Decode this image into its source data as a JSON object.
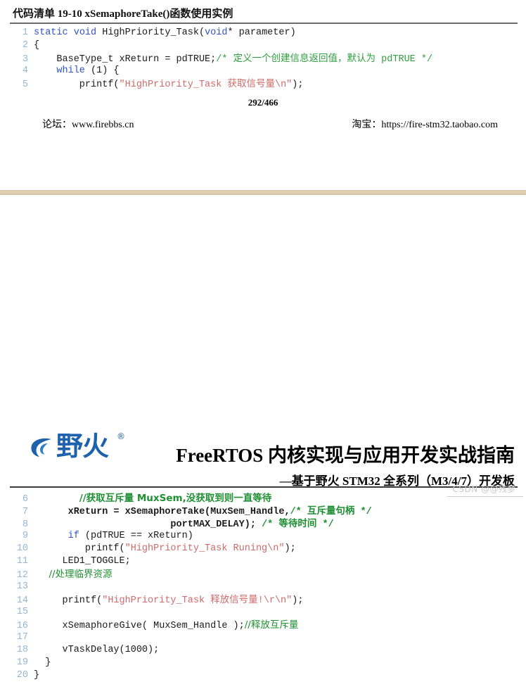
{
  "page_top": {
    "listing_title": "代码清单 19-10 xSemaphoreTake()函数使用实例",
    "page_number": "292",
    "page_separator": "/",
    "page_total": "466",
    "footer_left": "论坛：www.firebbs.cn",
    "footer_right": "淘宝：https://fire-stm32.taobao.com",
    "code_lines": [
      {
        "n": "1",
        "parts": [
          {
            "t": "static",
            "c": "kw"
          },
          {
            "t": " "
          },
          {
            "t": "void",
            "c": "kw"
          },
          {
            "t": " HighPriority_Task("
          },
          {
            "t": "void",
            "c": "kw"
          },
          {
            "t": "* parameter)"
          }
        ]
      },
      {
        "n": "2",
        "parts": [
          {
            "t": "{"
          }
        ]
      },
      {
        "n": "3",
        "parts": [
          {
            "t": "    BaseType_t xReturn = pdTRUE;"
          },
          {
            "t": "/* ",
            "c": "cmt"
          },
          {
            "t": "定义一个创建信息返回值，默认为",
            "c": "cmt cjk"
          },
          {
            "t": " pdTRUE */",
            "c": "cmt"
          }
        ]
      },
      {
        "n": "4",
        "parts": [
          {
            "t": "    "
          },
          {
            "t": "while",
            "c": "kw"
          },
          {
            "t": " (1) {"
          }
        ]
      },
      {
        "n": "5",
        "parts": [
          {
            "t": "        printf("
          },
          {
            "t": "\"HighPriority_Task ",
            "c": "str"
          },
          {
            "t": "获取信号量",
            "c": "str cjk"
          },
          {
            "t": "\\n\"",
            "c": "str"
          },
          {
            "t": ");"
          }
        ]
      }
    ]
  },
  "page_bottom": {
    "brand_name": "野火",
    "brand_registered": "®",
    "book_title": "FreeRTOS 内核实现与应用开发实战指南",
    "book_subtitle": "—基于野火 STM32 全系列（M3/4/7）开发板",
    "code_lines": [
      {
        "n": "6",
        "bold": true,
        "parts": [
          {
            "t": "        ",
            "c": ""
          },
          {
            "t": "//获取互斥量 MuxSem,没获取到则一直等待",
            "c": "cmt2 b cjk"
          }
        ]
      },
      {
        "n": "7",
        "bold": true,
        "parts": [
          {
            "t": "      xReturn = xSemaphoreTake(MuxSem_Handle,",
            "c": "b"
          },
          {
            "t": "/* ",
            "c": "cmt2 b"
          },
          {
            "t": "互斥量句柄",
            "c": "cmt2 b cjk"
          },
          {
            "t": " */",
            "c": "cmt2 b"
          }
        ]
      },
      {
        "n": "8",
        "bold": true,
        "parts": [
          {
            "t": "                        portMAX_DELAY); ",
            "c": "b"
          },
          {
            "t": "/* ",
            "c": "cmt2 b"
          },
          {
            "t": "等待时间",
            "c": "cmt2 b cjk"
          },
          {
            "t": " */",
            "c": "cmt2 b"
          }
        ]
      },
      {
        "n": "9",
        "parts": [
          {
            "t": "      "
          },
          {
            "t": "if",
            "c": "kw"
          },
          {
            "t": " (pdTRUE == xReturn)"
          }
        ]
      },
      {
        "n": "10",
        "parts": [
          {
            "t": "         printf("
          },
          {
            "t": "\"HighPriority_Task Runing\\n\"",
            "c": "str"
          },
          {
            "t": ");"
          }
        ]
      },
      {
        "n": "11",
        "parts": [
          {
            "t": "     LED1_TOGGLE;"
          }
        ]
      },
      {
        "n": "12",
        "parts": [
          {
            "t": "     //处理临界资源",
            "c": "cmt2 cjk"
          }
        ]
      },
      {
        "n": "13",
        "parts": [
          {
            "t": ""
          }
        ]
      },
      {
        "n": "14",
        "parts": [
          {
            "t": "     printf("
          },
          {
            "t": "\"HighPriority_Task ",
            "c": "str"
          },
          {
            "t": "释放信号量",
            "c": "str cjk"
          },
          {
            "t": "!\\r\\n\"",
            "c": "str"
          },
          {
            "t": ");"
          }
        ]
      },
      {
        "n": "15",
        "parts": [
          {
            "t": ""
          }
        ]
      },
      {
        "n": "16",
        "parts": [
          {
            "t": "     xSemaphoreGive( MuxSem_Handle );"
          },
          {
            "t": "//释放互斥量",
            "c": "cmt2 cjk"
          }
        ]
      },
      {
        "n": "17",
        "parts": [
          {
            "t": ""
          }
        ]
      },
      {
        "n": "18",
        "parts": [
          {
            "t": "     vTaskDelay(1000);"
          }
        ]
      },
      {
        "n": "19",
        "parts": [
          {
            "t": "  }"
          }
        ]
      },
      {
        "n": "20",
        "parts": [
          {
            "t": "}"
          }
        ]
      }
    ]
  },
  "watermark": {
    "text": "CSDN @@残梦"
  },
  "colors": {
    "keyword": "#2f53c8",
    "string": "#cf6a6a",
    "comment": "#2f9e3f",
    "line_number": "#93b7d8",
    "brand": "#1e62ad",
    "separator_band": "#dcc6a4"
  }
}
